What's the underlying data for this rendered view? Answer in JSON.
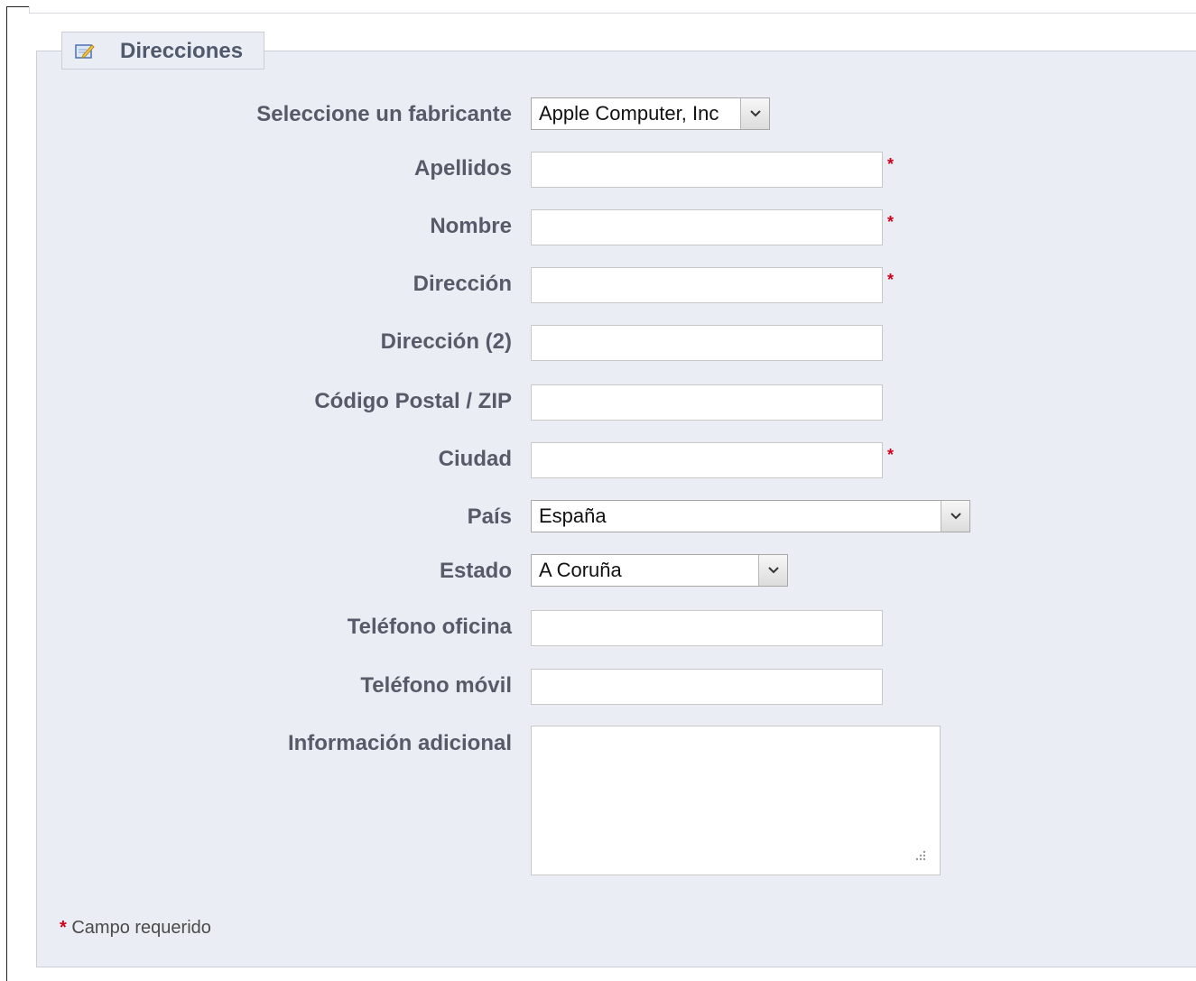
{
  "section": {
    "title": "Direcciones",
    "icon": "edit-note-icon"
  },
  "form": {
    "fabricante": {
      "label": "Seleccione un fabricante",
      "value": "Apple Computer, Inc"
    },
    "apellidos": {
      "label": "Apellidos",
      "value": "",
      "required": true
    },
    "nombre": {
      "label": "Nombre",
      "value": "",
      "required": true
    },
    "direccion": {
      "label": "Dirección",
      "value": "",
      "required": true
    },
    "direccion2": {
      "label": "Dirección (2)",
      "value": ""
    },
    "codigo_postal": {
      "label": "Código Postal / ZIP",
      "value": ""
    },
    "ciudad": {
      "label": "Ciudad",
      "value": "",
      "required": true
    },
    "pais": {
      "label": "País",
      "value": "España"
    },
    "estado": {
      "label": "Estado",
      "value": "A Coruña"
    },
    "telefono_oficina": {
      "label": "Teléfono oficina",
      "value": ""
    },
    "telefono_movil": {
      "label": "Teléfono móvil",
      "value": ""
    },
    "informacion_adicional": {
      "label": "Información adicional",
      "value": ""
    },
    "required_marker": "*"
  },
  "footer": {
    "required_marker": "*",
    "required_note": "Campo requerido"
  },
  "colors": {
    "panel_background": "#ebedf4",
    "label_text": "#585a69",
    "required_star": "#d0021b"
  }
}
